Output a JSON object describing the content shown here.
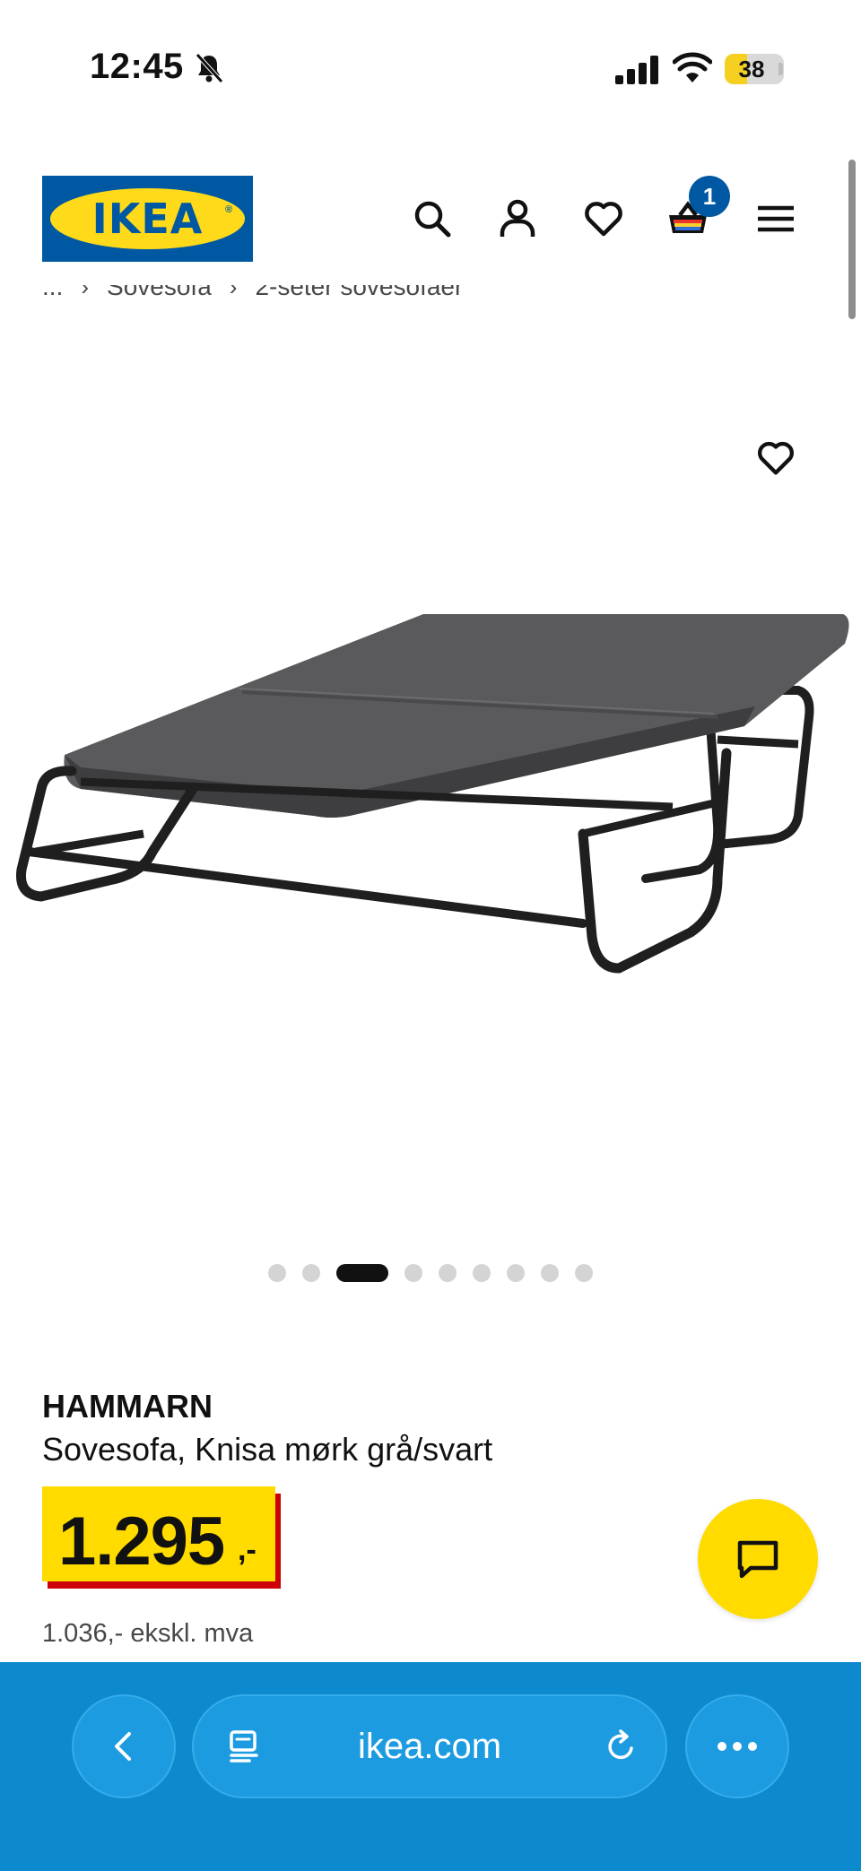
{
  "status_bar": {
    "time": "12:45",
    "battery_percent": 38
  },
  "header": {
    "logo_text": "IKEA",
    "logo_mark": "®",
    "cart_count": "1",
    "icons": [
      "search-icon",
      "profile-icon",
      "heart-icon",
      "cart-icon",
      "menu-icon"
    ]
  },
  "breadcrumb": {
    "items": [
      "...",
      "Sovesofa",
      "2-seter sovesofaer"
    ],
    "separator": "›"
  },
  "carousel": {
    "count": 9,
    "active_index": 2
  },
  "product": {
    "name": "HAMMARN",
    "description": "Sovesofa, Knisa mørk grå/svart",
    "price_integer": "1.295",
    "price_suffix": ",-",
    "price_excl_vat": "1.036,- ekskl. mva"
  },
  "browser": {
    "url": "ikea.com"
  },
  "colors": {
    "ikea_blue": "#0058a3",
    "ikea_yellow": "#ffdb00",
    "price_red": "#cc0008",
    "browser_bar": "#0d89cd"
  }
}
